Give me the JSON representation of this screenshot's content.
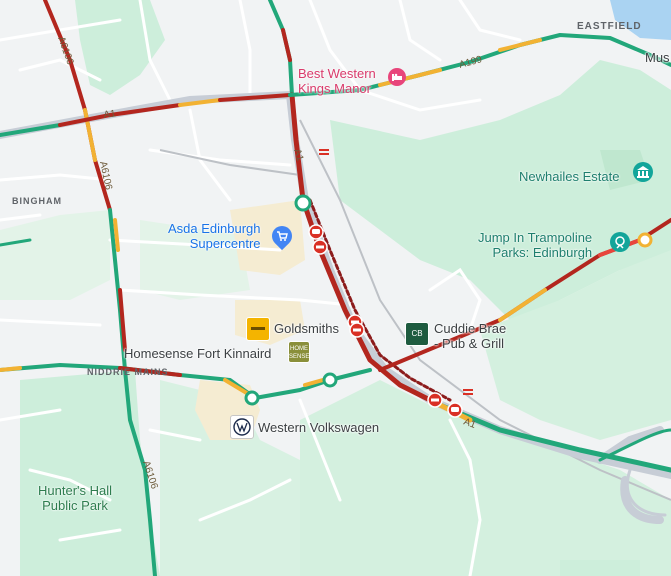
{
  "colors": {
    "traffic_red": "#b3261e",
    "traffic_orange": "#e8453c",
    "traffic_yellow": "#f2b233",
    "traffic_green": "#22a77a",
    "park": "#cfeedd",
    "water": "#aad3f2"
  },
  "areas": {
    "eastfield": "EASTFIELD",
    "bingham": "BINGHAM",
    "niddrie_mains": "NIDDRIE MAINS",
    "mus": "Mus"
  },
  "roads": {
    "a6106_top": "A6106",
    "a1_left": "A1",
    "a6106_mid": "A6106",
    "a199": "A199",
    "a1_center": "A1",
    "a1_bottom": "A1",
    "a6106_bottom": "A6106"
  },
  "places": {
    "best_western": "Best Western\nKings Manor",
    "newhailes": "Newhailes Estate",
    "asda": "Asda Edinburgh\nSupercentre",
    "jump_in": "Jump In Trampoline\nParks: Edinburgh",
    "goldsmiths": "Goldsmiths",
    "cuddie_brae": "Cuddie Brae\n- Pub & Grill",
    "homesense": "Homesense Fort Kinnaird",
    "western_vw": "Western Volkswagen",
    "hunters_hall": "Hunter's Hall\nPublic Park"
  },
  "logos": {
    "home_sense": "HOME SENSE",
    "cuddie_logo": "CB"
  },
  "icons": {
    "hotel": "hotel-icon",
    "rail": "rail-station-icon",
    "shopping": "shopping-cart-icon",
    "museum": "museum-icon",
    "amusement": "amusement-park-icon",
    "road_closure": "no-entry-icon",
    "crash": "crash-icon",
    "vw": "volkswagen-logo-icon"
  }
}
